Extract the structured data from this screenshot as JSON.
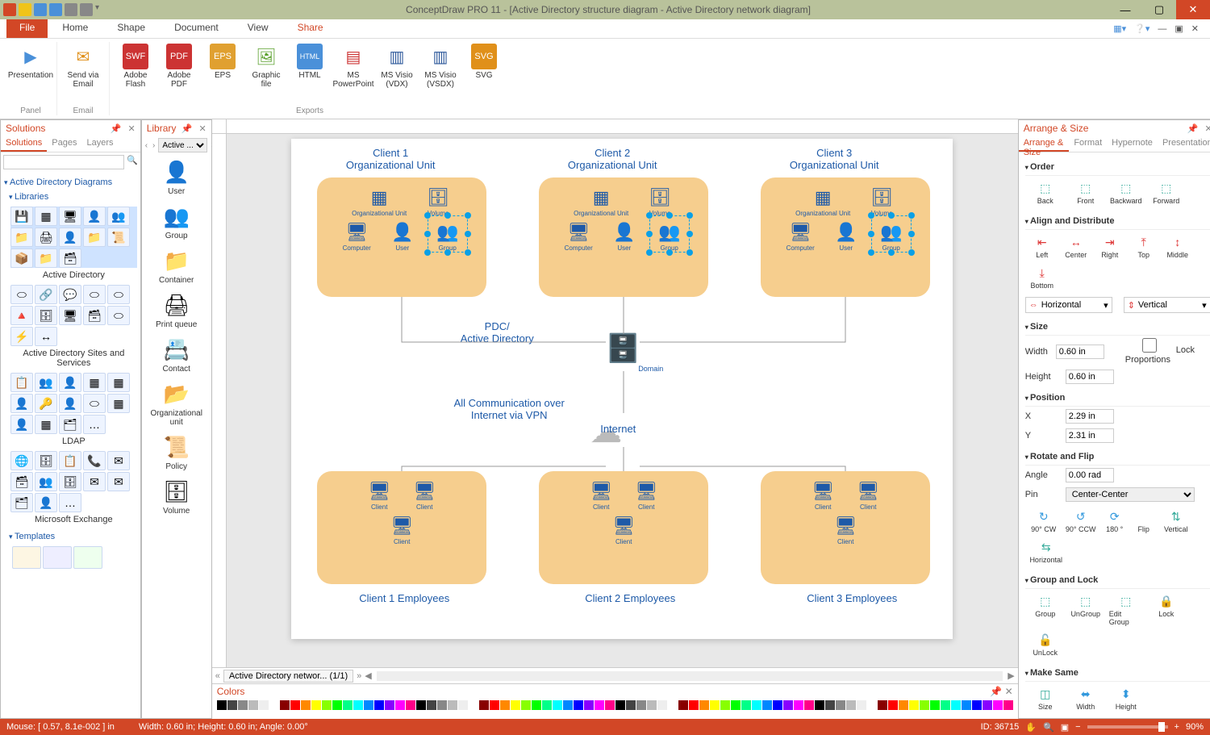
{
  "app_title": "ConceptDraw PRO 11 - [Active Directory structure diagram - Active Directory network diagram]",
  "ribbon": {
    "file": "File",
    "tabs": [
      "Home",
      "Shape",
      "Document",
      "View",
      "Share"
    ],
    "active_tab": "Share",
    "groups": {
      "panel": "Panel",
      "email": "Email",
      "exports": "Exports"
    },
    "items": {
      "presentation": "Presentation",
      "send_email": "Send via Email",
      "adobe_flash": "Adobe Flash",
      "adobe_pdf": "Adobe PDF",
      "eps": "EPS",
      "graphic": "Graphic file",
      "html": "HTML",
      "powerpoint": "MS PowerPoint",
      "visio_vdx": "MS Visio (VDX)",
      "visio_vsdx": "MS Visio (VSDX)",
      "svg": "SVG"
    }
  },
  "solutions": {
    "title": "Solutions",
    "tabs": [
      "Solutions",
      "Pages",
      "Layers"
    ],
    "tree_root": "Active Directory Diagrams",
    "heading_libraries": "Libraries",
    "heading_templates": "Templates",
    "libs": [
      "Active Directory",
      "Active Directory Sites and Services",
      "LDAP",
      "Microsoft Exchange"
    ]
  },
  "library": {
    "title": "Library",
    "combo": "Active ...",
    "shapes": [
      "User",
      "Group",
      "Container",
      "Print queue",
      "Contact",
      "Organizational unit",
      "Policy",
      "Volume"
    ]
  },
  "canvas": {
    "clients_top": [
      {
        "title1": "Client 1",
        "title2": "Organizational Unit"
      },
      {
        "title1": "Client 2",
        "title2": "Organizational Unit"
      },
      {
        "title1": "Client 3",
        "title2": "Organizational Unit"
      }
    ],
    "inner_labels": [
      "Organizational Unit",
      "Volume",
      "Computer",
      "User",
      "Group"
    ],
    "pdc": "PDC/\nActive Directory",
    "domain": "Domain",
    "comm": "All Communication over\nInternet via VPN",
    "internet": "Internet",
    "emp_box_label": "Client",
    "employees": [
      "Client 1 Employees",
      "Client 2 Employees",
      "Client 3 Employees"
    ],
    "doc_tab": "Active Directory networ... (1/1)"
  },
  "colors": {
    "title": "Colors"
  },
  "arrange": {
    "title": "Arrange & Size",
    "tabs": [
      "Arrange & Size",
      "Format",
      "Hypernote",
      "Presentation"
    ],
    "order": {
      "head": "Order",
      "back": "Back",
      "front": "Front",
      "backward": "Backward",
      "forward": "Forward"
    },
    "align": {
      "head": "Align and Distribute",
      "left": "Left",
      "center": "Center",
      "right": "Right",
      "top": "Top",
      "middle": "Middle",
      "bottom": "Bottom",
      "horizontal": "Horizontal",
      "vertical": "Vertical"
    },
    "size": {
      "head": "Size",
      "width_label": "Width",
      "width_val": "0.60 in",
      "height_label": "Height",
      "height_val": "0.60 in",
      "lock": "Lock Proportions"
    },
    "pos": {
      "head": "Position",
      "x_label": "X",
      "x_val": "2.29 in",
      "y_label": "Y",
      "y_val": "2.31 in"
    },
    "rotate": {
      "head": "Rotate and Flip",
      "angle_label": "Angle",
      "angle_val": "0.00 rad",
      "pin_label": "Pin",
      "pin_val": "Center-Center",
      "cw": "90° CW",
      "ccw": "90° CCW",
      "r180": "180 °",
      "flip": "Flip",
      "v": "Vertical",
      "h": "Horizontal"
    },
    "group": {
      "head": "Group and Lock",
      "group": "Group",
      "ungroup": "UnGroup",
      "edit": "Edit Group",
      "lock": "Lock",
      "unlock": "UnLock"
    },
    "same": {
      "head": "Make Same",
      "size": "Size",
      "width": "Width",
      "height": "Height"
    }
  },
  "status": {
    "mouse": "Mouse: [ 0.57, 8.1e-002 ] in",
    "dims": "Width: 0.60 in;  Height: 0.60 in;  Angle: 0.00°",
    "id": "ID: 36715",
    "zoom": "90%"
  }
}
